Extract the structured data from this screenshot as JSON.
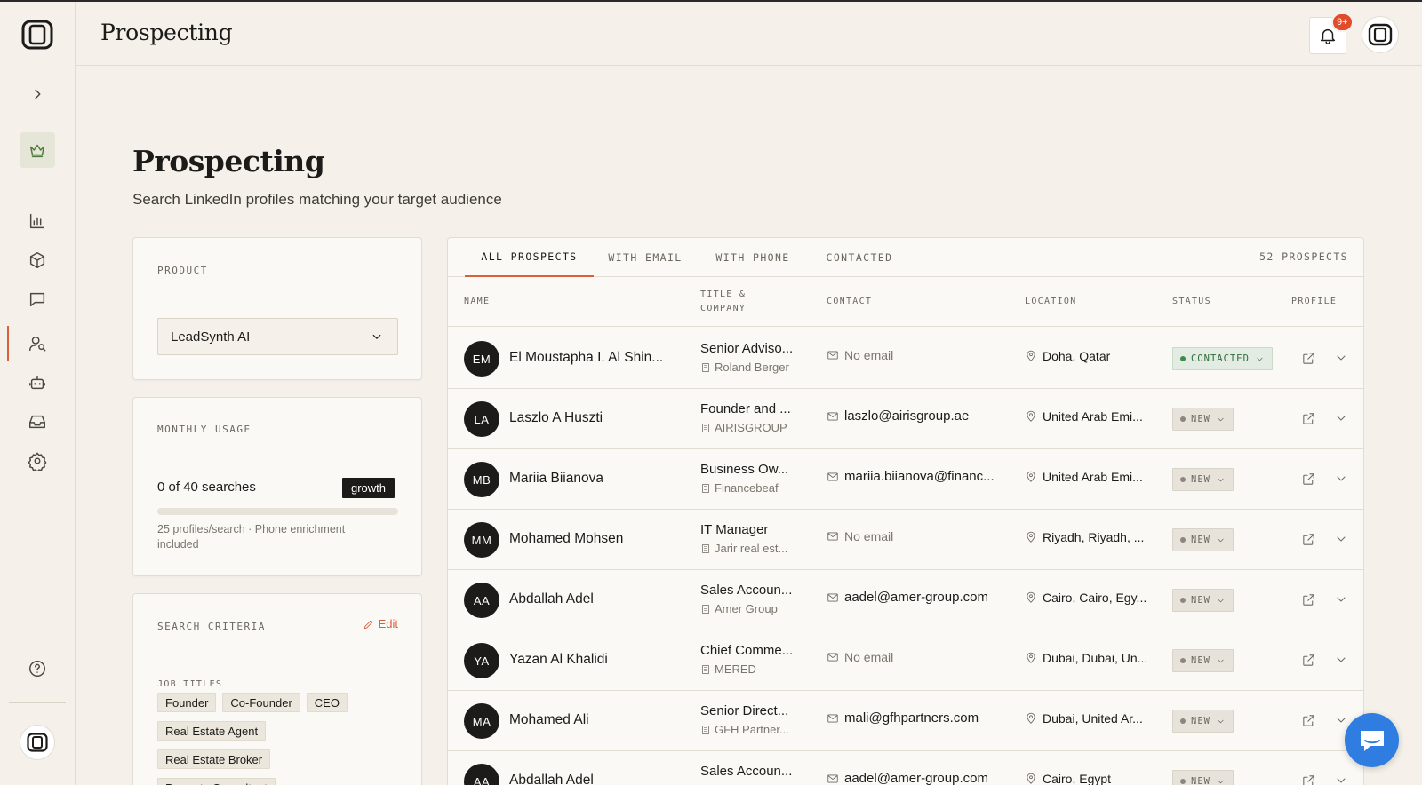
{
  "header": {
    "title": "Prospecting",
    "notification_badge": "9+"
  },
  "page": {
    "title": "Prospecting",
    "subtitle": "Search LinkedIn profiles matching your target audience"
  },
  "sidebar": {
    "icons": [
      "logo-icon",
      "chevron-right-icon",
      "crown-icon",
      "bar-chart-icon",
      "box-icon",
      "message-icon",
      "user-search-icon",
      "bot-icon",
      "inbox-icon",
      "gear-icon",
      "help-icon"
    ],
    "active_item": "prospecting"
  },
  "product_card": {
    "label": "PRODUCT",
    "selected": "LeadSynth AI"
  },
  "usage_card": {
    "label": "MONTHLY USAGE",
    "usage": "0 of 40 searches",
    "plan": "growth",
    "used": 0,
    "limit": 40,
    "note": "25 profiles/search · Phone enrichment included"
  },
  "criteria_card": {
    "label": "SEARCH CRITERIA",
    "edit_label": "Edit",
    "job_titles_label": "JOB TITLES",
    "job_titles": [
      "Founder",
      "Co-Founder",
      "CEO",
      "Real Estate Agent",
      "Real Estate Broker",
      "Property Consultant"
    ]
  },
  "tabs": [
    {
      "label": "ALL PROSPECTS",
      "active": true
    },
    {
      "label": "WITH EMAIL",
      "active": false
    },
    {
      "label": "WITH PHONE",
      "active": false
    },
    {
      "label": "CONTACTED",
      "active": false
    }
  ],
  "prospect_count": "52 PROSPECTS",
  "columns": {
    "name": "NAME",
    "title_line1": "TITLE &",
    "title_line2": "COMPANY",
    "contact": "CONTACT",
    "location": "LOCATION",
    "status": "STATUS",
    "profile": "PROFILE"
  },
  "rows": [
    {
      "initials": "EM",
      "name": "El Moustapha I. Al Shin...",
      "title": "Senior Adviso...",
      "company": "Roland Berger",
      "email": "No email",
      "has_email": false,
      "location": "Doha, Qatar",
      "status": "CONTACTED"
    },
    {
      "initials": "LA",
      "name": "Laszlo A Huszti",
      "title": "Founder and ...",
      "company": "AIRISGROUP",
      "email": "laszlo@airisgroup.ae",
      "has_email": true,
      "location": "United Arab Emi...",
      "status": "NEW"
    },
    {
      "initials": "MB",
      "name": "Mariia Biianova",
      "title": "Business Ow...",
      "company": "Financebeaf",
      "email": "mariia.biianova@financ...",
      "has_email": true,
      "location": "United Arab Emi...",
      "status": "NEW"
    },
    {
      "initials": "MM",
      "name": "Mohamed Mohsen",
      "title": "IT Manager",
      "company": "Jarir real est...",
      "email": "No email",
      "has_email": false,
      "location": "Riyadh, Riyadh, ...",
      "status": "NEW"
    },
    {
      "initials": "AA",
      "name": "Abdallah Adel",
      "title": "Sales Accoun...",
      "company": "Amer Group",
      "email": "aadel@amer-group.com",
      "has_email": true,
      "location": "Cairo, Cairo, Egy...",
      "status": "NEW"
    },
    {
      "initials": "YA",
      "name": "Yazan Al Khalidi",
      "title": "Chief Comme...",
      "company": "MERED",
      "email": "No email",
      "has_email": false,
      "location": "Dubai, Dubai, Un...",
      "status": "NEW"
    },
    {
      "initials": "MA",
      "name": "Mohamed Ali",
      "title": "Senior Direct...",
      "company": "GFH Partner...",
      "email": "mali@gfhpartners.com",
      "has_email": true,
      "location": "Dubai, United Ar...",
      "status": "NEW"
    },
    {
      "initials": "AA",
      "name": "Abdallah Adel",
      "title": "Sales Accoun...",
      "company": "",
      "email": "aadel@amer-group.com",
      "has_email": true,
      "location": "Cairo, Egypt",
      "status": "NEW"
    }
  ]
}
